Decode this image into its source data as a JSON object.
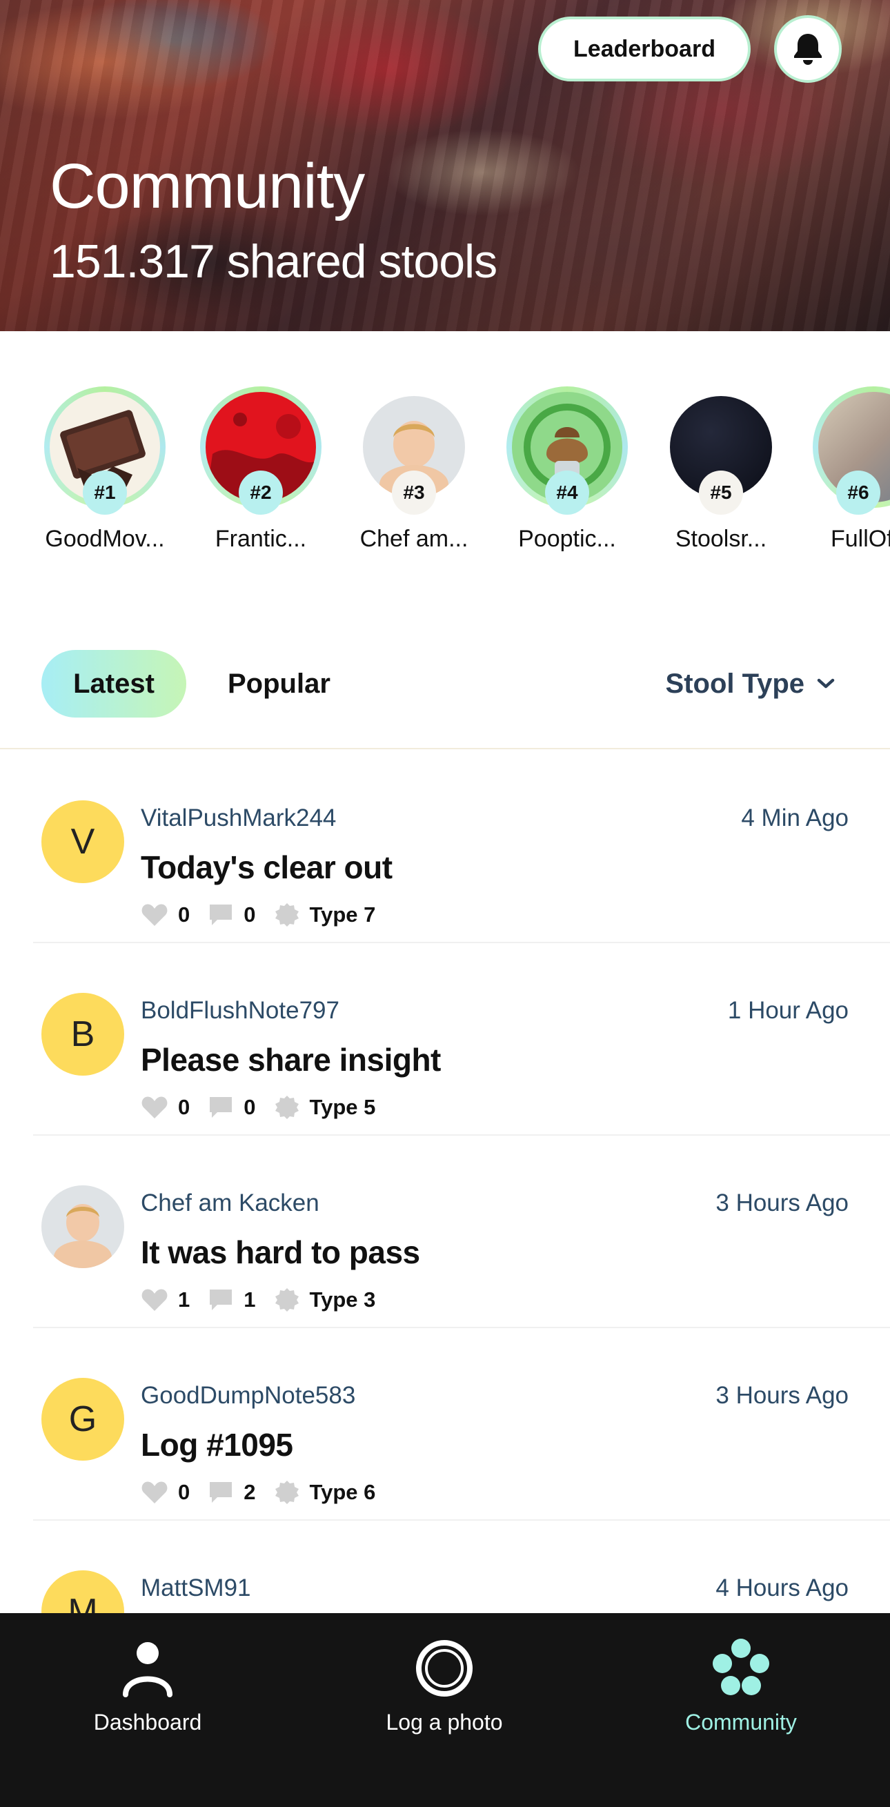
{
  "header": {
    "title": "Community",
    "subtitle": "151.317 shared stools",
    "leaderboard_label": "Leaderboard"
  },
  "top_users": [
    {
      "rank": "#1",
      "name": "GoodMov..."
    },
    {
      "rank": "#2",
      "name": "Frantic..."
    },
    {
      "rank": "#3",
      "name": "Chef am..."
    },
    {
      "rank": "#4",
      "name": "Pooptic..."
    },
    {
      "rank": "#5",
      "name": "Stoolsr..."
    },
    {
      "rank": "#6",
      "name": "FullOf"
    }
  ],
  "filters": {
    "latest": "Latest",
    "popular": "Popular",
    "stool_type": "Stool Type"
  },
  "posts": [
    {
      "initial": "V",
      "user": "VitalPushMark244",
      "time": "4 Min Ago",
      "title": "Today's clear out",
      "likes": "0",
      "comments": "0",
      "type": "Type 7"
    },
    {
      "initial": "B",
      "user": "BoldFlushNote797",
      "time": "1 Hour Ago",
      "title": "Please share insight",
      "likes": "0",
      "comments": "0",
      "type": "Type 5"
    },
    {
      "initial": "",
      "user": "Chef am Kacken",
      "time": "3 Hours Ago",
      "title": "It was hard to pass",
      "likes": "1",
      "comments": "1",
      "type": "Type 3"
    },
    {
      "initial": "G",
      "user": "GoodDumpNote583",
      "time": "3 Hours Ago",
      "title": "Log #1095",
      "likes": "0",
      "comments": "2",
      "type": "Type 6"
    },
    {
      "initial": "M",
      "user": "MattSM91",
      "time": "4 Hours Ago",
      "title": "",
      "likes": "",
      "comments": "",
      "type": ""
    }
  ],
  "nav": {
    "dashboard": "Dashboard",
    "log_photo": "Log a photo",
    "community": "Community"
  },
  "colors": {
    "accent_teal": "#9ff0e4",
    "avatar_yellow": "#fddb5c",
    "nav_bg": "#141414"
  }
}
